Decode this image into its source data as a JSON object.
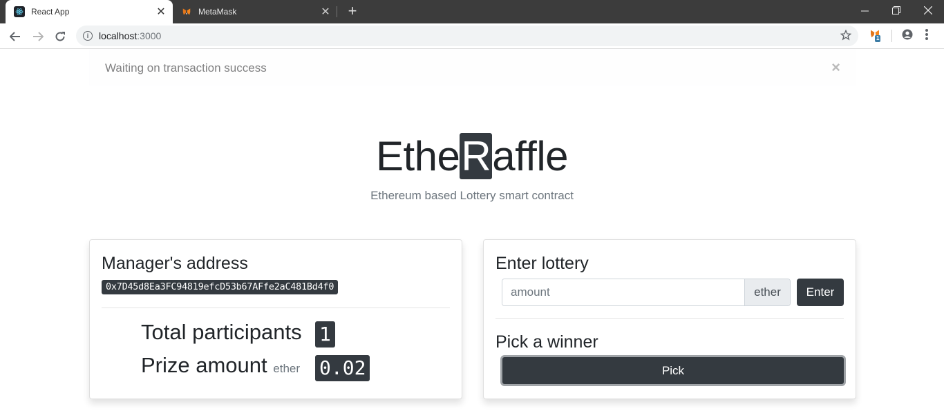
{
  "browser": {
    "tabs": [
      {
        "title": "React App",
        "active": true
      },
      {
        "title": "MetaMask",
        "active": false
      }
    ],
    "new_tab": "+",
    "url_host": "localhost",
    "url_port": ":3000",
    "extension_badge": "1"
  },
  "alert": {
    "message": "Waiting on transaction success",
    "close": "×"
  },
  "brand": {
    "prefix": "Ethe",
    "highlight": "R",
    "suffix": "affle",
    "tagline": "Ethereum based Lottery smart contract"
  },
  "manager_card": {
    "title": "Manager's address",
    "address": "0x7D45d8Ea3FC94819efcD53b67AFfe2aC481Bd4f0",
    "participants_label": "Total participants",
    "participants_value": "1",
    "prize_label": "Prize amount",
    "prize_unit": "ether",
    "prize_value": "0.02"
  },
  "lottery_card": {
    "enter_title": "Enter lottery",
    "amount_placeholder": "amount",
    "amount_value": "",
    "amount_unit": "ether",
    "enter_button": "Enter",
    "pick_title": "Pick a winner",
    "pick_button": "Pick"
  },
  "colors": {
    "dark": "#343a40",
    "muted": "#6c757d",
    "tabbar": "#3c3c3c"
  }
}
